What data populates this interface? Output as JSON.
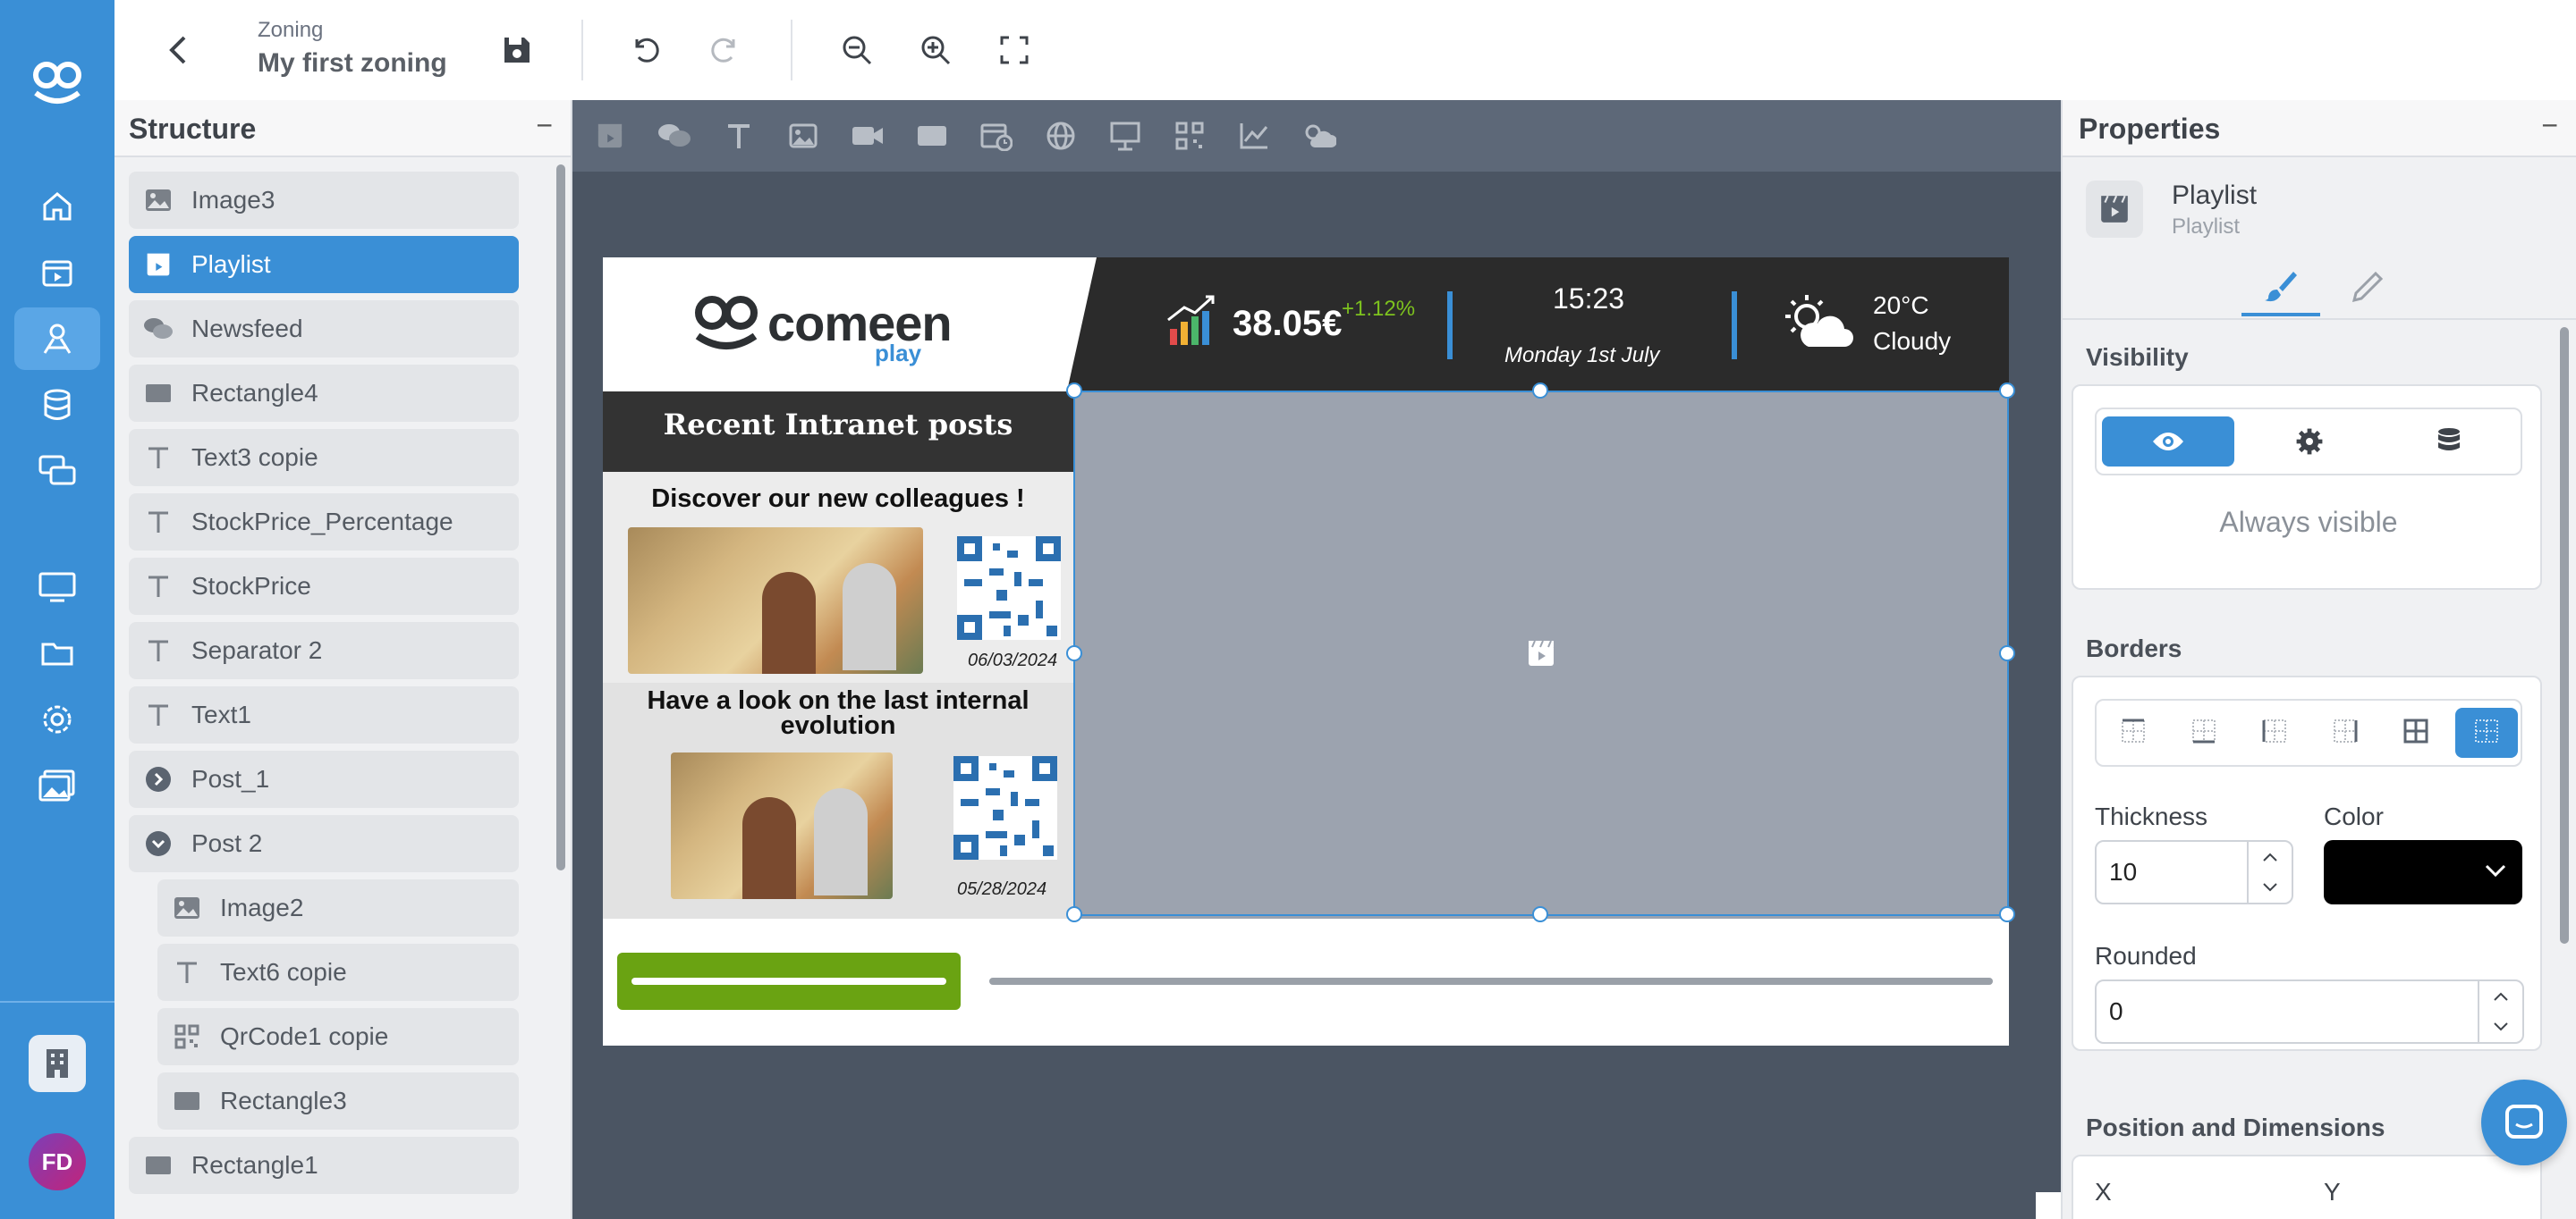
{
  "topbar": {
    "breadcrumb": "Zoning",
    "title": "My first zoning"
  },
  "nav": {
    "user_initials": "FD",
    "icons": [
      "logo-icon",
      "home-icon",
      "media-icon",
      "zoning-icon",
      "database-icon",
      "chat-icon",
      "screen-icon",
      "folder-icon",
      "settings-icon",
      "gallery-icon",
      "building-icon"
    ]
  },
  "structure": {
    "title": "Structure",
    "collapse": "−",
    "items": [
      {
        "label": "Image3",
        "icon": "image-icon"
      },
      {
        "label": "Playlist",
        "icon": "playlist-icon",
        "active": true
      },
      {
        "label": "Newsfeed",
        "icon": "newsfeed-icon"
      },
      {
        "label": "Rectangle4",
        "icon": "rectangle-icon"
      },
      {
        "label": "Text3 copie",
        "icon": "text-icon"
      },
      {
        "label": "StockPrice_Percentage",
        "icon": "text-icon"
      },
      {
        "label": "StockPrice",
        "icon": "text-icon"
      },
      {
        "label": "Separator 2",
        "icon": "text-icon"
      },
      {
        "label": "Text1",
        "icon": "text-icon"
      },
      {
        "label": "Post_1",
        "icon": "expand-icon"
      },
      {
        "label": "Post 2",
        "icon": "collapse-icon"
      },
      {
        "label": "Image2",
        "icon": "image-icon"
      },
      {
        "label": "Text6 copie",
        "icon": "text-icon"
      },
      {
        "label": "QrCode1 copie",
        "icon": "qrcode-icon"
      },
      {
        "label": "Rectangle3",
        "icon": "rectangle-icon"
      },
      {
        "label": "Rectangle1",
        "icon": "rectangle-icon"
      }
    ]
  },
  "screen": {
    "brand": "comeen",
    "brand_sub": "play",
    "stock_price": "38.05€",
    "stock_change": "+1.12%",
    "time": "15:23",
    "date": "Monday 1st July",
    "temperature": "20°C",
    "weather": "Cloudy",
    "posts_title": "Recent Intranet posts",
    "posts": [
      {
        "title": "Discover our new colleagues !",
        "date": "06/03/2024"
      },
      {
        "title": "Have a look on the last internal evolution",
        "date": "05/28/2024"
      }
    ]
  },
  "properties": {
    "title": "Properties",
    "collapse": "−",
    "element_name": "Playlist",
    "element_type": "Playlist",
    "visibility_label": "Visibility",
    "visibility_text": "Always visible",
    "borders_label": "Borders",
    "thickness_label": "Thickness",
    "thickness_value": "10",
    "color_label": "Color",
    "color_value": "#000000",
    "rounded_label": "Rounded",
    "rounded_value": "0",
    "position_label": "Position and Dimensions",
    "x_label": "X",
    "y_label": "Y"
  },
  "colors": {
    "accent": "#3a8fd6",
    "green": "#6aa312",
    "stock_up": "#7dc21e"
  }
}
